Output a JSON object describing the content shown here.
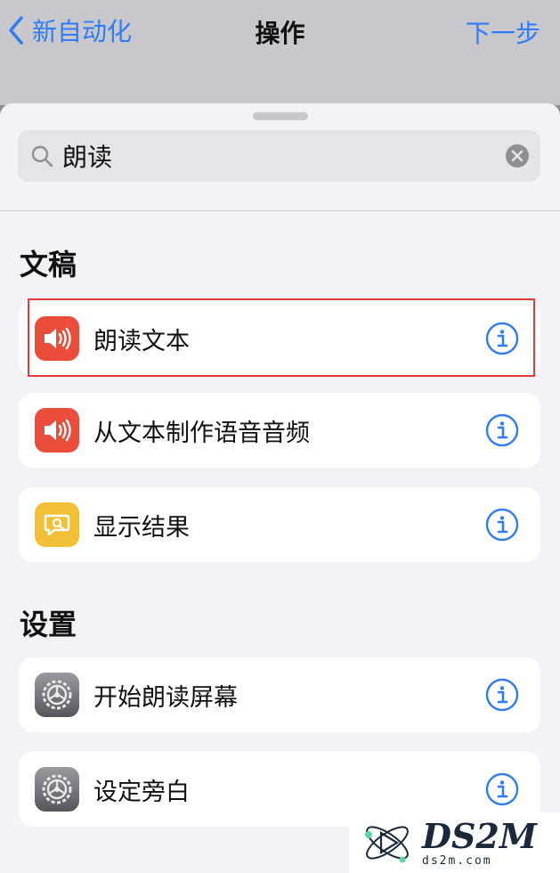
{
  "nav": {
    "back_label": "新自动化",
    "title": "操作",
    "next_label": "下一步"
  },
  "search": {
    "value": "朗读"
  },
  "sections": [
    {
      "title": "文稿",
      "items": [
        {
          "label": "朗读文本",
          "icon": "speaker-icon"
        },
        {
          "label": "从文本制作语音音频",
          "icon": "speaker-icon"
        },
        {
          "label": "显示结果",
          "icon": "show-result-icon"
        }
      ]
    },
    {
      "title": "设置",
      "items": [
        {
          "label": "开始朗读屏幕",
          "icon": "settings-gear-icon"
        },
        {
          "label": "设定旁白",
          "icon": "settings-gear-icon"
        }
      ]
    }
  ],
  "watermark": {
    "brand": "DS2M",
    "domain": "ds2m.com"
  },
  "colors": {
    "accent": "#2f7cf6",
    "highlight": "#e23b3b",
    "red_icon": "#eb4d3d",
    "yellow_icon": "#f2c037"
  }
}
